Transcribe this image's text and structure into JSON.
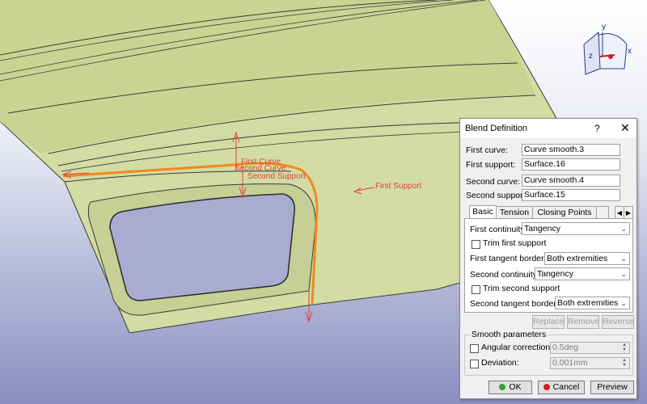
{
  "viewport": {
    "labels": {
      "first_curve": "First Curve",
      "second_curve": "Second Curve",
      "second_support": "Second Support",
      "first_support": "First Support"
    },
    "compass": {
      "axis_x": "x",
      "axis_y": "y",
      "axis_z": "z"
    }
  },
  "dialog": {
    "title": "Blend Definition",
    "help": "?",
    "close": "✕",
    "first_curve_label": "First curve:",
    "first_curve_value": "Curve smooth.3",
    "first_support_label": "First support:",
    "first_support_value": "Surface.16",
    "second_curve_label": "Second curve:",
    "second_curve_value": "Curve smooth.4",
    "second_support_label": "Second support:",
    "second_support_value": "Surface.15",
    "tabs": [
      "Basic",
      "Tension",
      "Closing Points"
    ],
    "tab_scroll_left": "◀",
    "tab_scroll_right": "▶",
    "first_continuity_label": "First continuity:",
    "first_continuity_value": "Tangency",
    "trim_first_support_label": "Trim first support",
    "first_tangent_borders_label": "First tangent borders:",
    "first_tangent_borders_value": "Both extremities",
    "second_continuity_label": "Second continuity:",
    "second_continuity_value": "Tangency",
    "trim_second_support_label": "Trim second support",
    "second_tangent_borders_label": "Second tangent borders:",
    "second_tangent_borders_value": "Both extremities",
    "replace_label": "Replace",
    "remove_label": "Remove",
    "reverse_label": "Reverse",
    "smooth_parameters_title": "Smooth parameters",
    "angular_correction_label": "Angular correction:",
    "angular_correction_value": "0.5deg",
    "deviation_label": "Deviation:",
    "deviation_value": "0.001mm",
    "ok_label": "OK",
    "cancel_label": "Cancel",
    "preview_label": "Preview"
  },
  "colors": {
    "surface": "#d2dba0",
    "blend_curve": "#f08a1c",
    "annotation_red": "#e04040",
    "ok_dot": "#2aa82a",
    "cancel_dot": "#d02020"
  }
}
